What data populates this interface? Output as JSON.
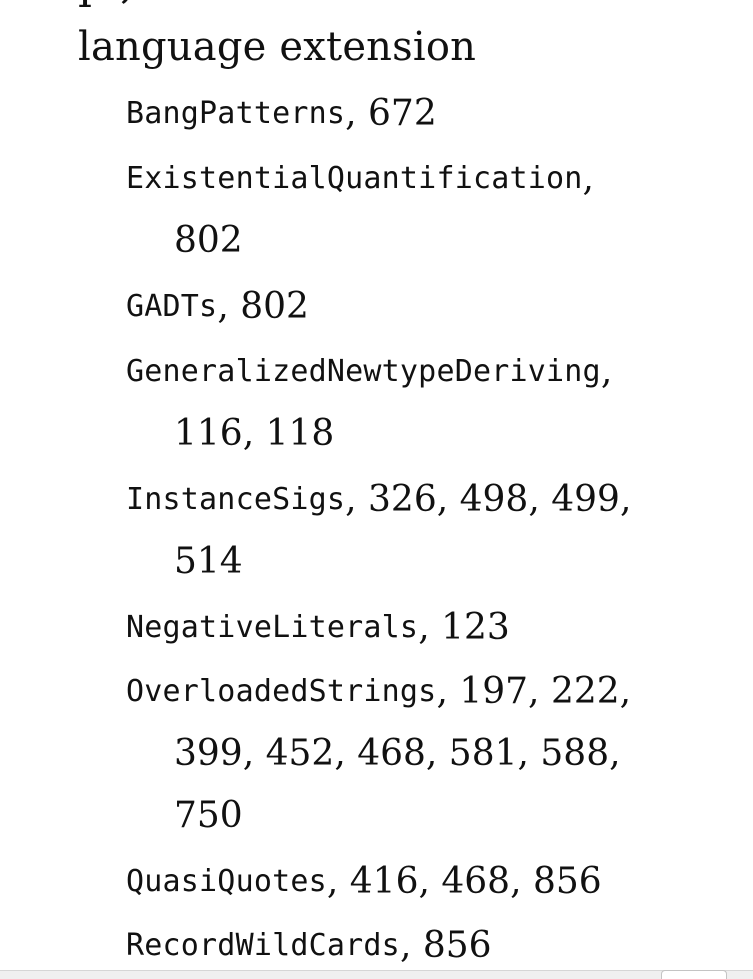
{
  "index": {
    "partial_top_text": "p , ",
    "heading": "language extension",
    "entries": [
      {
        "name": "BangPatterns",
        "lines": [
          ", 672"
        ]
      },
      {
        "name": "ExistentialQuantification",
        "lines": [
          ",",
          "802"
        ]
      },
      {
        "name": "GADTs",
        "lines": [
          ", 802"
        ]
      },
      {
        "name": "GeneralizedNewtypeDeriving",
        "lines": [
          ",",
          "116, 118"
        ]
      },
      {
        "name": "InstanceSigs",
        "lines": [
          ", 326, 498, 499,",
          "514"
        ]
      },
      {
        "name": "NegativeLiterals",
        "lines": [
          ", 123"
        ]
      },
      {
        "name": "OverloadedStrings",
        "lines": [
          ", 197, 222,",
          "399, 452, 468, 581, 588,",
          "750"
        ]
      },
      {
        "name": "QuasiQuotes",
        "lines": [
          ", 416, 468, 856"
        ]
      },
      {
        "name": "RecordWildCards",
        "lines": [
          ", 856"
        ]
      }
    ]
  }
}
